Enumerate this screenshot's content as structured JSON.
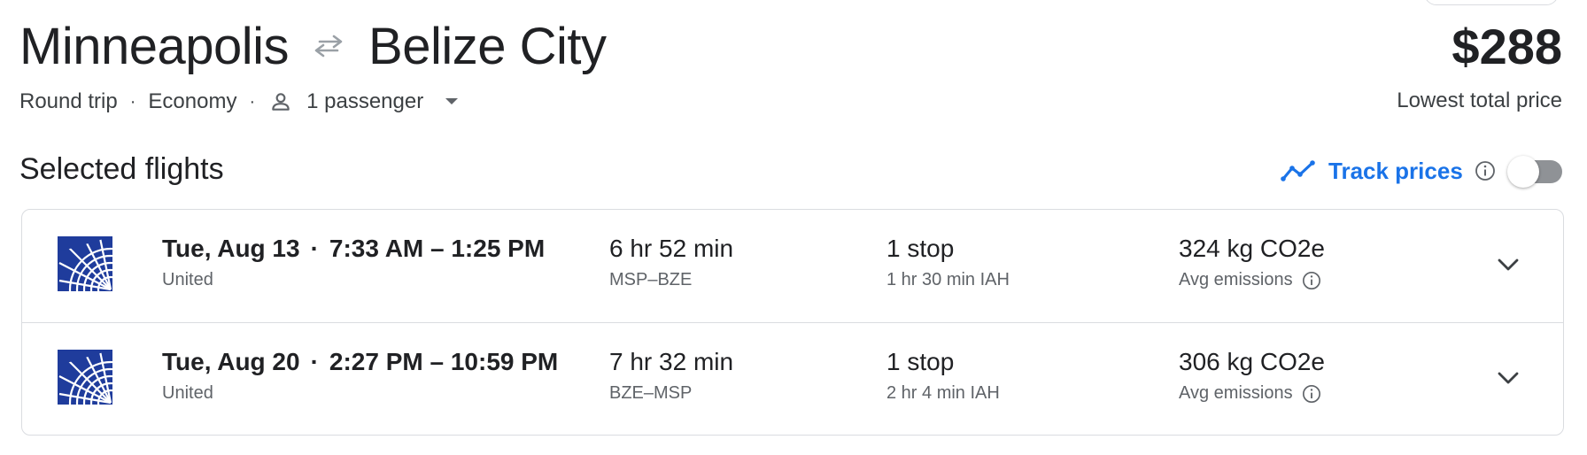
{
  "header": {
    "origin": "Minneapolis",
    "destination": "Belize City",
    "price": "$288",
    "price_caption": "Lowest total price",
    "trip_type": "Round trip",
    "cabin": "Economy",
    "passengers": "1 passenger"
  },
  "section": {
    "title": "Selected flights",
    "track_label": "Track prices",
    "track_enabled": false
  },
  "flights": [
    {
      "date": "Tue, Aug 13",
      "times": "7:33 AM – 1:25 PM",
      "airline": "United",
      "duration": "6 hr 52 min",
      "route": "MSP–BZE",
      "stops": "1 stop",
      "layover": "1 hr 30 min IAH",
      "emissions": "324 kg CO2e",
      "emissions_label": "Avg emissions"
    },
    {
      "date": "Tue, Aug 20",
      "times": "2:27 PM – 10:59 PM",
      "airline": "United",
      "duration": "7 hr 32 min",
      "route": "BZE–MSP",
      "stops": "1 stop",
      "layover": "2 hr 4 min IAH",
      "emissions": "306 kg CO2e",
      "emissions_label": "Avg emissions"
    }
  ],
  "colors": {
    "accent": "#1a73e8",
    "united_blue": "#1f3c9c",
    "text_primary": "#202124",
    "text_secondary": "#5f6368",
    "border": "#dadce0",
    "toggle_off": "#8f9296"
  },
  "icons": {
    "swap": "swap-arrows-icon",
    "person": "person-icon",
    "caret": "caret-down-icon",
    "trend": "trend-line-icon",
    "info": "info-icon",
    "expand": "chevron-down-icon",
    "airline_logo": "united-globe-logo"
  }
}
